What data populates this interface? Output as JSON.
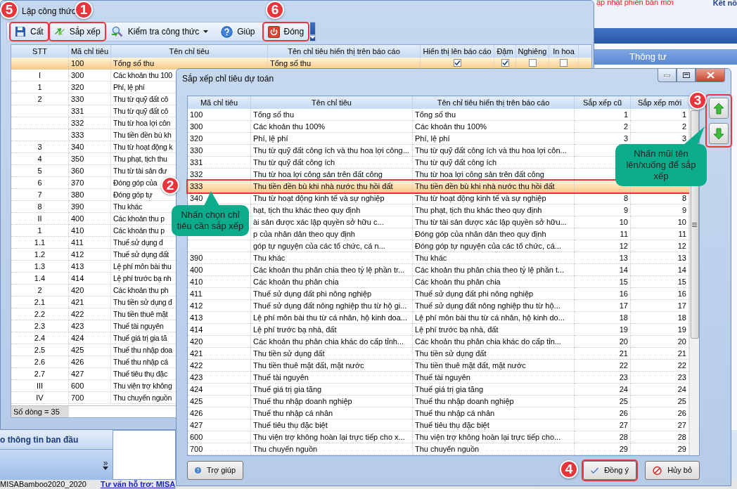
{
  "background_app": {
    "update_notice": "ập nhật phiên bản mới",
    "connect_label": "Kết nố",
    "panel_header": "Thông tư",
    "sidebar_header": "o thông tin ban đầu",
    "sidebar_more": "»",
    "status_bar": [
      "MISABamboo2020_2020",
      "Tư vấn hỗ trợ: MISA"
    ]
  },
  "main_window": {
    "title": "Lập công thức",
    "toolbar": [
      {
        "label": "Cất",
        "dropdown": false,
        "highlighted": true
      },
      {
        "label": "Sắp xếp",
        "dropdown": false,
        "highlighted": true
      },
      {
        "label": "Kiểm tra công thức",
        "dropdown": true,
        "highlighted": false
      },
      {
        "label": "Giúp",
        "dropdown": false,
        "highlighted": false
      },
      {
        "label": "Đóng",
        "dropdown": false,
        "highlighted": true
      }
    ],
    "columns": [
      "STT",
      "Mã chỉ tiêu",
      "Tên chỉ tiêu",
      "Tên chỉ tiêu hiển thị trên báo cáo",
      "Hiển thị lên báo cáo",
      "Đậm",
      "Nghiêng",
      "In hoa"
    ],
    "rows": [
      {
        "stt": "",
        "code": "100",
        "name": "Tổng số thu",
        "display_name": "Tổng số thu",
        "show": true,
        "bold": true,
        "italic": false,
        "upper": false,
        "selected": true
      },
      {
        "stt": "I",
        "code": "300",
        "name": "Các khoản thu 100",
        "selected": false
      },
      {
        "stt": "1",
        "code": "320",
        "name": "Phí, lệ phí",
        "selected": false
      },
      {
        "stt": "2",
        "code": "330",
        "name": "Thu từ quỹ đất cô",
        "selected": false
      },
      {
        "stt": "",
        "code": "331",
        "name": "Thu từ quỹ đất cô",
        "selected": false
      },
      {
        "stt": "",
        "code": "332",
        "name": "Thu từ hoa lợi côn",
        "selected": false
      },
      {
        "stt": "",
        "code": "333",
        "name": "Thu tiền đền bù kh",
        "selected": false
      },
      {
        "stt": "3",
        "code": "340",
        "name": "Thu từ hoạt động k",
        "selected": false
      },
      {
        "stt": "4",
        "code": "350",
        "name": "Thu phạt, tịch thu",
        "selected": false
      },
      {
        "stt": "5",
        "code": "360",
        "name": "Thu từ tài sản đư",
        "selected": false
      },
      {
        "stt": "6",
        "code": "370",
        "name": "Đóng góp của",
        "selected": false
      },
      {
        "stt": "7",
        "code": "380",
        "name": "Đóng góp tự",
        "selected": false
      },
      {
        "stt": "8",
        "code": "390",
        "name": "Thu khác",
        "selected": false
      },
      {
        "stt": "II",
        "code": "400",
        "name": "Các khoản thu p",
        "selected": false
      },
      {
        "stt": "1",
        "code": "410",
        "name": "Các khoản thu p",
        "selected": false
      },
      {
        "stt": "1.1",
        "code": "411",
        "name": "Thuế sử dụng đ",
        "selected": false
      },
      {
        "stt": "1.2",
        "code": "412",
        "name": "Thuế sử dụng đất",
        "selected": false
      },
      {
        "stt": "1.3",
        "code": "413",
        "name": "Lệ phí môn bài thu",
        "selected": false
      },
      {
        "stt": "1.4",
        "code": "414",
        "name": "Lệ phí trước bạ nh",
        "selected": false
      },
      {
        "stt": "2",
        "code": "420",
        "name": "Các khoản thu ph",
        "selected": false
      },
      {
        "stt": "2.1",
        "code": "421",
        "name": "Thu tiền sử dụng đ",
        "selected": false
      },
      {
        "stt": "2.2",
        "code": "422",
        "name": "Thu tiền thuê mặt",
        "selected": false
      },
      {
        "stt": "2.3",
        "code": "423",
        "name": "Thuế tài nguyên",
        "selected": false
      },
      {
        "stt": "2.4",
        "code": "424",
        "name": "Thuế giá trị gia tă",
        "selected": false
      },
      {
        "stt": "2.5",
        "code": "425",
        "name": "Thuế thu nhập doa",
        "selected": false
      },
      {
        "stt": "2.6",
        "code": "426",
        "name": "Thuế thu nhập cá",
        "selected": false
      },
      {
        "stt": "2.7",
        "code": "427",
        "name": "Thuế tiêu thụ đặc",
        "selected": false
      },
      {
        "stt": "III",
        "code": "600",
        "name": "Thu viện trợ không",
        "selected": false
      },
      {
        "stt": "IV",
        "code": "700",
        "name": "Thu chuyển nguồn",
        "selected": false
      }
    ],
    "row_count": "Số dòng = 35"
  },
  "dialog": {
    "title": "Sắp xếp chỉ tiêu dự toán",
    "columns": [
      "Mã chỉ tiêu",
      "Tên chỉ tiêu",
      "Tên chỉ tiêu hiển thị trên báo cáo",
      "Sắp xếp cũ",
      "Sắp xếp mới"
    ],
    "rows": [
      {
        "code": "100",
        "name": "Tổng số thu",
        "display_name": "Tổng số thu",
        "old_order": "1",
        "new_order": "1",
        "selected": false,
        "highlighted": false
      },
      {
        "code": "300",
        "name": "Các khoản thu 100%",
        "display_name": "Các khoản thu 100%",
        "old_order": "2",
        "new_order": "2",
        "selected": false,
        "highlighted": false
      },
      {
        "code": "320",
        "name": "Phí, lệ phí",
        "display_name": "Phí, lệ phí",
        "old_order": "3",
        "new_order": "3",
        "selected": false,
        "highlighted": false
      },
      {
        "code": "330",
        "name": "Thu từ quỹ đất công ích và thu hoa lợi công...",
        "display_name": "Thu từ quỹ đất công ích và thu hoa lợi côn...",
        "selected": false,
        "highlighted": false
      },
      {
        "code": "331",
        "name": "Thu từ quỹ đất công ích",
        "display_name": "Thu từ quỹ đất công ích",
        "selected": false,
        "highlighted": false
      },
      {
        "code": "332",
        "name": "Thu từ hoa lợi công sản trên đất công",
        "display_name": "Thu từ hoa lợi công sản trên đất công",
        "selected": false,
        "highlighted": false
      },
      {
        "code": "333",
        "name": "Thu tiền đền bù khi nhà nước thu hồi đất",
        "display_name": "Thu tiền đền bù khi nhà nước thu hồi đất",
        "selected": true,
        "highlighted": true
      },
      {
        "code": "340",
        "name": "Thu từ hoạt động kinh tế và sự nghiệp",
        "display_name": "Thu từ hoạt động kinh tế và sự nghiệp",
        "old_order": "8",
        "new_order": "8",
        "selected": false,
        "highlighted": false
      },
      {
        "name": "hạt, tịch thu khác theo quy định",
        "display_name": "Thu phạt, tịch thu khác theo quy định",
        "old_order": "9",
        "new_order": "9",
        "selected": false,
        "highlighted": false
      },
      {
        "name": "ài sản được xác lập quyền sở hữu c...",
        "display_name": "Thu từ tài sản được xác lập quyền sở hữu...",
        "old_order": "10",
        "new_order": "10",
        "selected": false,
        "highlighted": false
      },
      {
        "name": "p của nhân dân theo quy định",
        "display_name": "Đóng góp của nhân dân theo quy định",
        "old_order": "11",
        "new_order": "11",
        "selected": false,
        "highlighted": false
      },
      {
        "name": "góp tự nguyện của các tổ chức, cá n...",
        "display_name": "Đóng góp tự nguyện của các tổ chức, cá...",
        "old_order": "12",
        "new_order": "12",
        "selected": false,
        "highlighted": false
      },
      {
        "code": "390",
        "name": "Thu khác",
        "display_name": "Thu khác",
        "old_order": "13",
        "new_order": "13",
        "selected": false,
        "highlighted": false
      },
      {
        "code": "400",
        "name": "Các khoản thu phân chia theo tỷ lệ phần tr...",
        "display_name": "Các khoản thu phân chia theo tỷ lệ phần t...",
        "old_order": "14",
        "new_order": "14",
        "selected": false,
        "highlighted": false
      },
      {
        "code": "410",
        "name": "Các khoản thu phân chia",
        "display_name": "Các khoản thu phân chia",
        "old_order": "15",
        "new_order": "15",
        "selected": false,
        "highlighted": false
      },
      {
        "code": "411",
        "name": "Thuế sử dụng đất phi nông nghiệp",
        "display_name": "Thuế sử dụng đất phi nông nghiệp",
        "old_order": "16",
        "new_order": "16",
        "selected": false,
        "highlighted": false
      },
      {
        "code": "412",
        "name": "Thuế sử dụng đất nông nghiệp thu từ hộ gi...",
        "display_name": "Thuế sử dụng đất nông nghiệp thu từ hộ...",
        "old_order": "17",
        "new_order": "17",
        "selected": false,
        "highlighted": false
      },
      {
        "code": "413",
        "name": "Lệ phí môn bài thu từ cá nhân, hộ kinh doa...",
        "display_name": "Lệ phí môn bài thu từ cá nhân, hộ kinh do...",
        "old_order": "18",
        "new_order": "18",
        "selected": false,
        "highlighted": false
      },
      {
        "code": "414",
        "name": "Lệ phí trước bạ nhà, đất",
        "display_name": "Lệ phí trước bạ nhà, đất",
        "old_order": "19",
        "new_order": "19",
        "selected": false,
        "highlighted": false
      },
      {
        "code": "420",
        "name": "Các khoản thu phân chia khác do cấp tỉnh...",
        "display_name": "Các khoản thu phân chia khác do cấp tỉn...",
        "old_order": "20",
        "new_order": "20",
        "selected": false,
        "highlighted": false
      },
      {
        "code": "421",
        "name": "Thu tiền sử dụng đất",
        "display_name": "Thu tiền sử dụng đất",
        "old_order": "21",
        "new_order": "21",
        "selected": false,
        "highlighted": false
      },
      {
        "code": "422",
        "name": "Thu tiền thuê mặt đất, mặt nước",
        "display_name": "Thu tiền thuê mặt đất, mặt nước",
        "old_order": "22",
        "new_order": "22",
        "selected": false,
        "highlighted": false
      },
      {
        "code": "423",
        "name": "Thuế tài nguyên",
        "display_name": "Thuế tài nguyên",
        "old_order": "23",
        "new_order": "23",
        "selected": false,
        "highlighted": false
      },
      {
        "code": "424",
        "name": "Thuế giá trị gia tăng",
        "display_name": "Thuế giá trị gia tăng",
        "old_order": "24",
        "new_order": "24",
        "selected": false,
        "highlighted": false
      },
      {
        "code": "425",
        "name": "Thuế thu nhập doanh nghiệp",
        "display_name": "Thuế thu nhập doanh nghiệp",
        "old_order": "25",
        "new_order": "25",
        "selected": false,
        "highlighted": false
      },
      {
        "code": "426",
        "name": "Thuế thu nhập cá nhân",
        "display_name": "Thuế thu nhập cá nhân",
        "old_order": "26",
        "new_order": "26",
        "selected": false,
        "highlighted": false
      },
      {
        "code": "427",
        "name": "Thuế tiêu thụ đặc biệt",
        "display_name": "Thuế tiêu thụ đặc biệt",
        "old_order": "27",
        "new_order": "27",
        "selected": false,
        "highlighted": false
      },
      {
        "code": "600",
        "name": "Thu viện trợ không hoàn lại trực tiếp cho x...",
        "display_name": "Thu viện trợ không hoàn lại trực tiếp cho...",
        "old_order": "28",
        "new_order": "28",
        "selected": false,
        "highlighted": false
      },
      {
        "code": "700",
        "name": "Thu chuyển nguồn",
        "display_name": "Thu chuyển nguồn",
        "old_order": "29",
        "new_order": "29",
        "selected": false,
        "highlighted": false
      }
    ],
    "order_buttons": {
      "highlighted": true
    },
    "buttons": [
      {
        "label": "Trợ giúp",
        "highlighted": false
      },
      {
        "label": "Đồng ý",
        "highlighted": true
      },
      {
        "label": "Hủy bỏ",
        "highlighted": false
      }
    ]
  },
  "annotations": {
    "badges": [
      "5",
      "1",
      "6",
      "2",
      "3",
      "4"
    ],
    "callouts": [
      "Nhấn chọn chỉ tiêu cần sắp xếp",
      "Nhấn mũi tên lên/xuống để sắp xếp"
    ]
  }
}
